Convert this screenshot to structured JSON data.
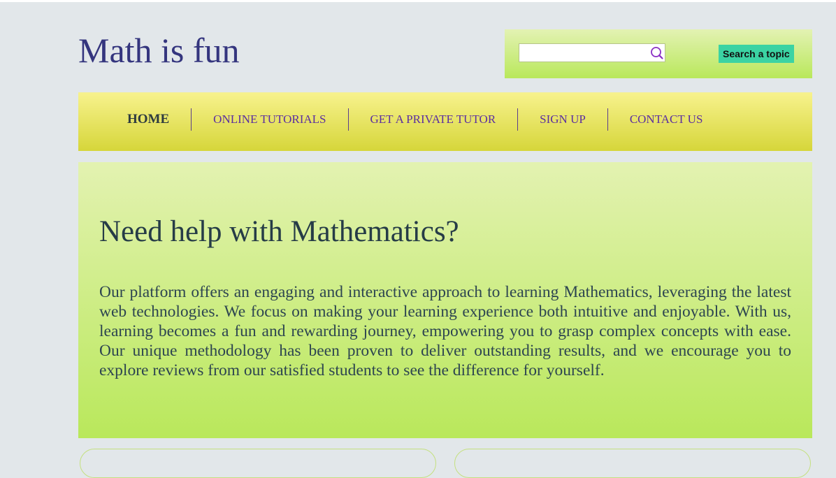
{
  "header": {
    "site_title": "Math is fun",
    "search": {
      "placeholder": "",
      "value": "",
      "icon": "search-icon",
      "button_label": "Search a topic"
    }
  },
  "nav": {
    "items": [
      {
        "label": "HOME",
        "active": true
      },
      {
        "label": "ONLINE TUTORIALS",
        "active": false
      },
      {
        "label": "GET A PRIVATE TUTOR",
        "active": false
      },
      {
        "label": "SIGN UP",
        "active": false
      },
      {
        "label": "CONTACT US",
        "active": false
      }
    ]
  },
  "hero": {
    "title": "Need help with Mathematics?",
    "body": "Our platform offers an engaging and interactive approach to learning Mathematics, leveraging the latest web technologies. We focus on making your learning experience both intuitive and enjoyable. With us, learning becomes a fun and rewarding journey, empowering you to grasp complex concepts with ease. Our unique methodology has been proven to deliver outstanding results, and we encourage you to explore reviews from our satisfied students to see the difference for yourself."
  },
  "colors": {
    "page_background": "#e2e7ea",
    "title_color": "#34357e",
    "nav_link": "#5b2ea0",
    "nav_active": "#2e3b3f",
    "search_button": "#3bd3a3",
    "hero_text": "#263c47"
  }
}
